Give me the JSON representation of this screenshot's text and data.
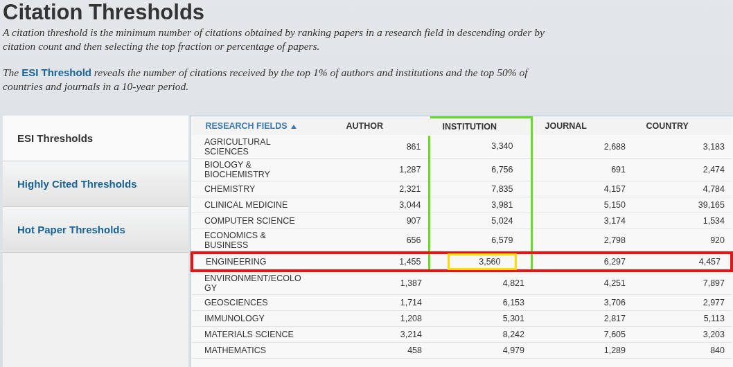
{
  "page": {
    "title": "Citation Thresholds",
    "intro": [
      "*A citation threshold is the minimum number of citations obtained by ranking papers in a research field in descending order by citation count and then selecting the top fraction or percentage of papers.*",
      "*The* **ESI Threshold** *reveals the number of citations received by the top 1% of authors and institutions and the top 50% of countries and journals in a 10-year period.*"
    ]
  },
  "sidebar": {
    "items": [
      {
        "label": "ESI Thresholds",
        "selected": true
      },
      {
        "label": "Highly Cited Thresholds",
        "selected": false
      },
      {
        "label": "Hot Paper Thresholds",
        "selected": false
      }
    ]
  },
  "table": {
    "columns": [
      {
        "label": "RESEARCH FIELDS",
        "sorted": true,
        "boxed": false
      },
      {
        "label": "AUTHOR",
        "sorted": false,
        "boxed": false
      },
      {
        "label": "INSTITUTION",
        "sorted": false,
        "boxed": true
      },
      {
        "label": "JOURNAL",
        "sorted": false,
        "boxed": false
      },
      {
        "label": "COUNTRY",
        "sorted": false,
        "boxed": false
      }
    ],
    "rows": [
      {
        "field": "AGRICULTURAL SCIENCES",
        "boxed": false,
        "values": [
          {
            "text": "861",
            "boxed": false
          },
          {
            "text": "3,340",
            "boxed": false
          },
          {
            "text": "2,688",
            "boxed": false
          },
          {
            "text": "3,183",
            "boxed": false
          }
        ]
      },
      {
        "field": "BIOLOGY & BIOCHEMISTRY",
        "boxed": false,
        "values": [
          {
            "text": "1,287",
            "boxed": false
          },
          {
            "text": "6,756",
            "boxed": false
          },
          {
            "text": "691",
            "boxed": false
          },
          {
            "text": "2,474",
            "boxed": false
          }
        ]
      },
      {
        "field": "CHEMISTRY",
        "boxed": false,
        "values": [
          {
            "text": "2,321",
            "boxed": false
          },
          {
            "text": "7,835",
            "boxed": false
          },
          {
            "text": "4,157",
            "boxed": false
          },
          {
            "text": "4,784",
            "boxed": false
          }
        ]
      },
      {
        "field": "CLINICAL MEDICINE",
        "boxed": false,
        "values": [
          {
            "text": "3,044",
            "boxed": false
          },
          {
            "text": "3,981",
            "boxed": false
          },
          {
            "text": "5,150",
            "boxed": false
          },
          {
            "text": "39,165",
            "boxed": false
          }
        ]
      },
      {
        "field": "COMPUTER SCIENCE",
        "boxed": false,
        "values": [
          {
            "text": "907",
            "boxed": false
          },
          {
            "text": "5,024",
            "boxed": false
          },
          {
            "text": "3,174",
            "boxed": false
          },
          {
            "text": "1,534",
            "boxed": false
          }
        ]
      },
      {
        "field": "ECONOMICS & BUSINESS",
        "boxed": false,
        "values": [
          {
            "text": "656",
            "boxed": false
          },
          {
            "text": "6,579",
            "boxed": false
          },
          {
            "text": "2,798",
            "boxed": false
          },
          {
            "text": "920",
            "boxed": false
          }
        ]
      },
      {
        "field": "ENGINEERING",
        "boxed": true,
        "values": [
          {
            "text": "1,455",
            "boxed": false
          },
          {
            "text": "3,560",
            "boxed": true
          },
          {
            "text": "6,297",
            "boxed": false
          },
          {
            "text": "4,457",
            "boxed": false
          }
        ]
      },
      {
        "field": "ENVIRONMENT/ECOLOGY",
        "boxed": false,
        "values": [
          {
            "text": "1,387",
            "boxed": false
          },
          {
            "text": "4,821",
            "boxed": false
          },
          {
            "text": "4,251",
            "boxed": false
          },
          {
            "text": "7,897",
            "boxed": false
          }
        ]
      },
      {
        "field": "GEOSCIENCES",
        "boxed": false,
        "values": [
          {
            "text": "1,714",
            "boxed": false
          },
          {
            "text": "6,153",
            "boxed": false
          },
          {
            "text": "3,706",
            "boxed": false
          },
          {
            "text": "2,977",
            "boxed": false
          }
        ]
      },
      {
        "field": "IMMUNOLOGY",
        "boxed": false,
        "values": [
          {
            "text": "1,208",
            "boxed": false
          },
          {
            "text": "5,301",
            "boxed": false
          },
          {
            "text": "2,817",
            "boxed": false
          },
          {
            "text": "5,113",
            "boxed": false
          }
        ]
      },
      {
        "field": "MATERIALS SCIENCE",
        "boxed": false,
        "values": [
          {
            "text": "3,214",
            "boxed": false
          },
          {
            "text": "8,242",
            "boxed": false
          },
          {
            "text": "7,605",
            "boxed": false
          },
          {
            "text": "3,203",
            "boxed": false
          }
        ]
      },
      {
        "field": "MATHEMATICS",
        "boxed": false,
        "values": [
          {
            "text": "458",
            "boxed": false
          },
          {
            "text": "4,979",
            "boxed": false
          },
          {
            "text": "1,289",
            "boxed": false
          },
          {
            "text": "840",
            "boxed": false
          }
        ]
      }
    ]
  }
}
